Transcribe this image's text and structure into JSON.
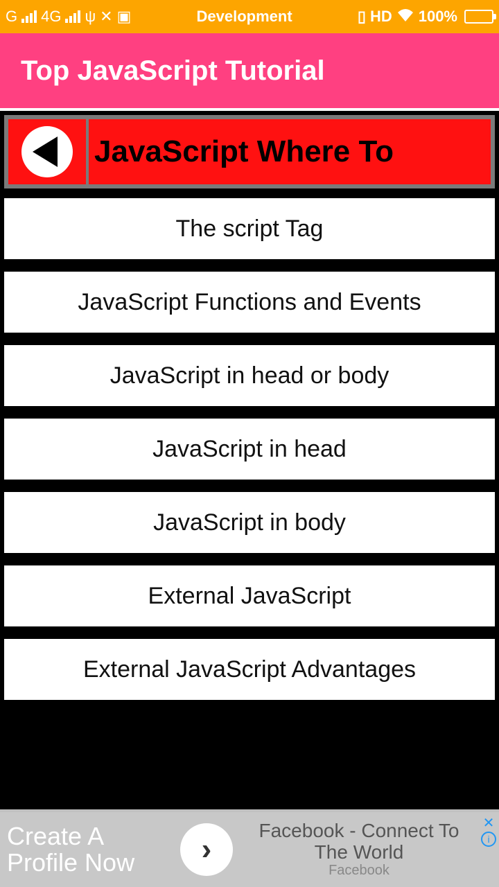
{
  "status_bar": {
    "carrier": "G",
    "network": "4G",
    "dev_label": "Development",
    "hd": "HD",
    "battery_pct": "100%",
    "vibrate_icon": "}{"
  },
  "app": {
    "title": "Top JavaScript Tutorial"
  },
  "page": {
    "header_title": "JavaScript Where To",
    "items": [
      "The script Tag",
      "JavaScript Functions and Events",
      "JavaScript in head or body",
      "JavaScript in head",
      "JavaScript in body",
      "External JavaScript",
      "External JavaScript Advantages"
    ]
  },
  "ad": {
    "left_line1": "Create A",
    "left_line2": "Profile Now",
    "right_title": "Facebook - Connect To The World",
    "right_sub": "Facebook"
  }
}
